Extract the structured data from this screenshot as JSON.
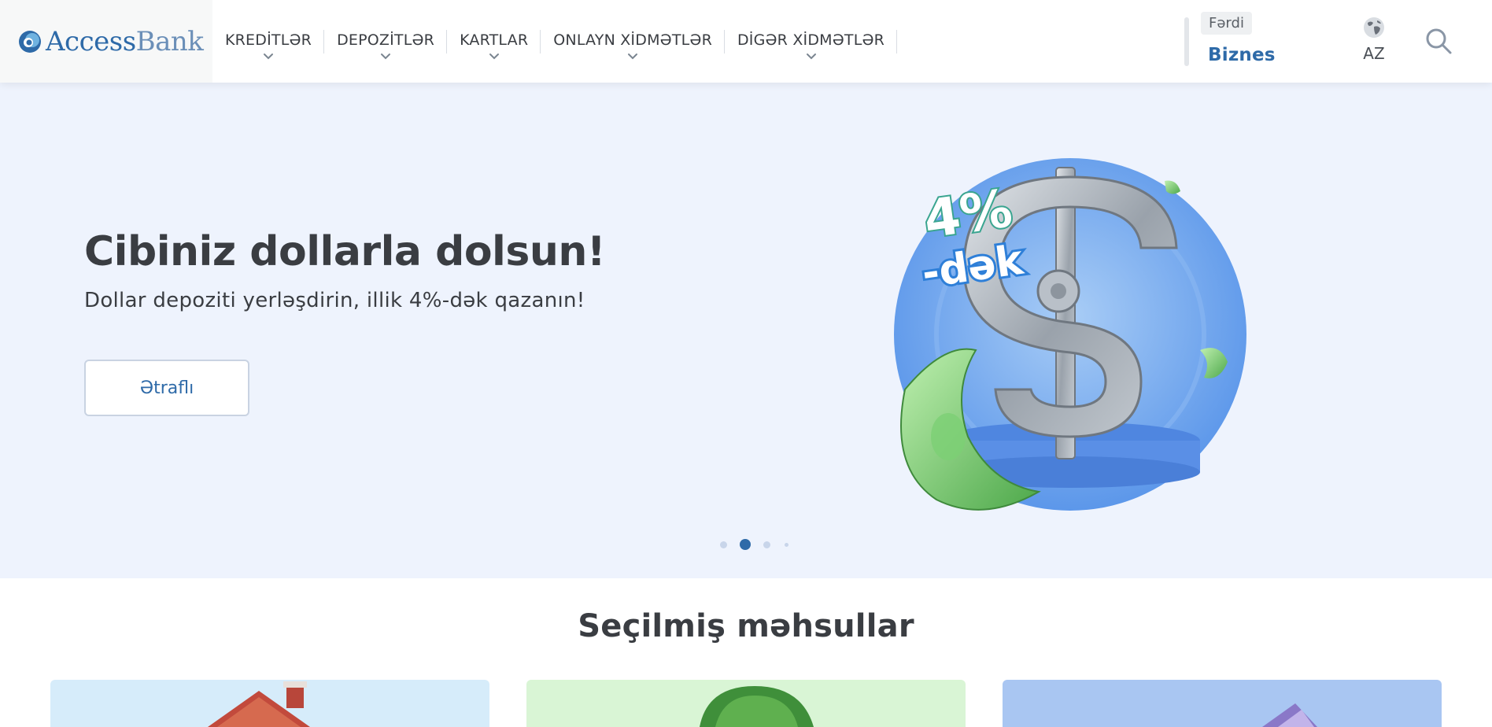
{
  "header": {
    "logo": {
      "primary": "Access",
      "secondary": "Bank"
    },
    "nav": [
      {
        "label": "KREDİTLƏR"
      },
      {
        "label": "DEPOZİTLƏR"
      },
      {
        "label": "KARTLAR"
      },
      {
        "label": "ONLAYN XİDMƏTLƏR"
      },
      {
        "label": "DİGƏR XİDMƏTLƏR"
      }
    ],
    "segment": {
      "personal": "Fərdi",
      "business": "Biznes"
    },
    "language": "AZ"
  },
  "hero": {
    "title": "Cibiniz dollarla dolsun!",
    "subtitle": "Dollar depoziti yerləşdirin, illik 4%-dək qazanın!",
    "button": "Ətraflı",
    "badge_top": "4%",
    "badge_bottom": "-dək",
    "carousel": {
      "count": 4,
      "active_index": 1
    }
  },
  "products": {
    "title": "Seçilmiş məhsullar"
  },
  "colors": {
    "brand_blue": "#2e6aa8",
    "hero_bg": "#eef3fd",
    "text_dark": "#3a3d42"
  }
}
